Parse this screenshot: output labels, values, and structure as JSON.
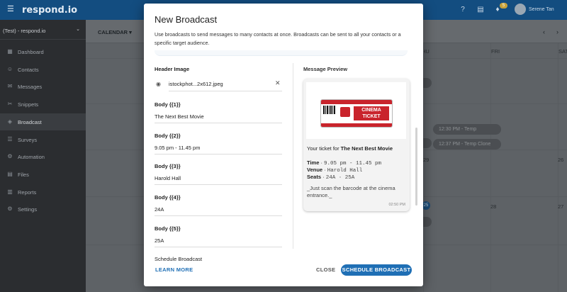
{
  "app": {
    "logo": "respond.io",
    "user_name": "Serene Tan",
    "notification_count": "5"
  },
  "workspace": {
    "name": "(Test) - respond.io"
  },
  "sidebar": {
    "items": [
      {
        "label": "Dashboard",
        "icon": "grid-icon"
      },
      {
        "label": "Contacts",
        "icon": "contacts-icon"
      },
      {
        "label": "Messages",
        "icon": "messages-icon"
      },
      {
        "label": "Snippets",
        "icon": "snippets-icon"
      },
      {
        "label": "Broadcast",
        "icon": "broadcast-icon",
        "active": true
      },
      {
        "label": "Surveys",
        "icon": "surveys-icon"
      },
      {
        "label": "Automation",
        "icon": "automation-icon"
      },
      {
        "label": "Files",
        "icon": "files-icon"
      },
      {
        "label": "Reports",
        "icon": "reports-icon"
      },
      {
        "label": "Settings",
        "icon": "settings-icon"
      }
    ]
  },
  "calendar": {
    "view_label": "CALENDAR",
    "day_headers": [
      "HU",
      "FRI",
      "SAT"
    ],
    "day_numbers": [
      "29",
      "28",
      "26",
      "27"
    ],
    "events": [
      "12:30 PM - Temp",
      "12:37 PM - Temp Clone"
    ],
    "highlight_badge": "25"
  },
  "modal": {
    "title": "New Broadcast",
    "description": "Use broadcasts to send messages to many contacts at once. Broadcasts can be sent to all your contacts or a specific target audience.",
    "header_image_label": "Header Image",
    "header_image_file": "istockphot...2x612.jpeg",
    "fields": [
      {
        "label": "Body {{1}}",
        "value": "The Next Best Movie"
      },
      {
        "label": "Body {{2}}",
        "value": "9.05 pm - 11.45 pm"
      },
      {
        "label": "Body {{3}}",
        "value": "Harold Hall"
      },
      {
        "label": "Body {{4}}",
        "value": "24A"
      },
      {
        "label": "Body {{5}}",
        "value": "25A"
      }
    ],
    "schedule_label": "Schedule Broadcast",
    "preview_label": "Message Preview",
    "preview": {
      "ticket_text": "CINEMA TICKET",
      "intro_prefix": "Your ticket for ",
      "intro_bold": "The Next Best Movie",
      "time_label": "Time",
      "time_value": "9.05 pm - 11.45 pm",
      "venue_label": "Venue",
      "venue_value": "Harold Hall",
      "seats_label": "Seats",
      "seats_value": "24A · 25A",
      "footer_note": "_Just scan the barcode at the cinema entrance._",
      "timestamp": "02:50 PM"
    },
    "learn_more": "LEARN MORE",
    "close": "CLOSE",
    "schedule_button": "SCHEDULE BROADCAST"
  },
  "colors": {
    "accent": "#1f6fb5",
    "topbar": "#134d80",
    "ticket_red": "#c9242c"
  }
}
